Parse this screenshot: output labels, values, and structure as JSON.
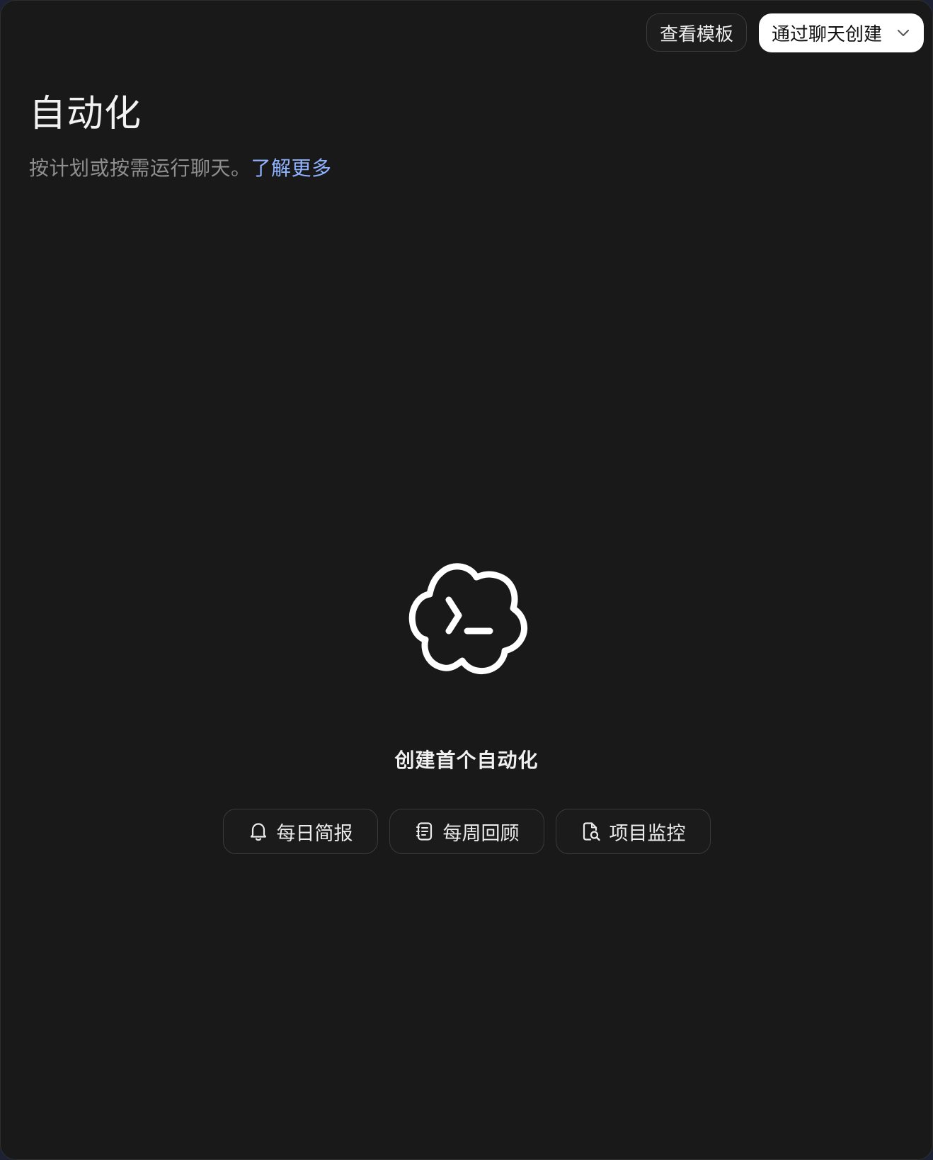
{
  "header": {
    "templates_button": "查看模板",
    "create_button": "通过聊天创建",
    "create_chevron_icon": "chevron-down-icon"
  },
  "main": {
    "title": "自动化",
    "subtitle": "按计划或按需运行聊天。",
    "learn_more": "了解更多"
  },
  "empty_state": {
    "icon": "cloud-terminal-icon",
    "title": "创建首个自动化",
    "suggestions": [
      {
        "label": "每日简报",
        "icon": "bell-icon"
      },
      {
        "label": "每周回顾",
        "icon": "notebook-icon"
      },
      {
        "label": "项目监控",
        "icon": "file-search-icon"
      }
    ]
  },
  "colors": {
    "background": "#191919",
    "text": "#f2f2f2",
    "muted": "#8f8f8f",
    "link": "#8fb3ff",
    "primary_button": "#ffffff"
  }
}
